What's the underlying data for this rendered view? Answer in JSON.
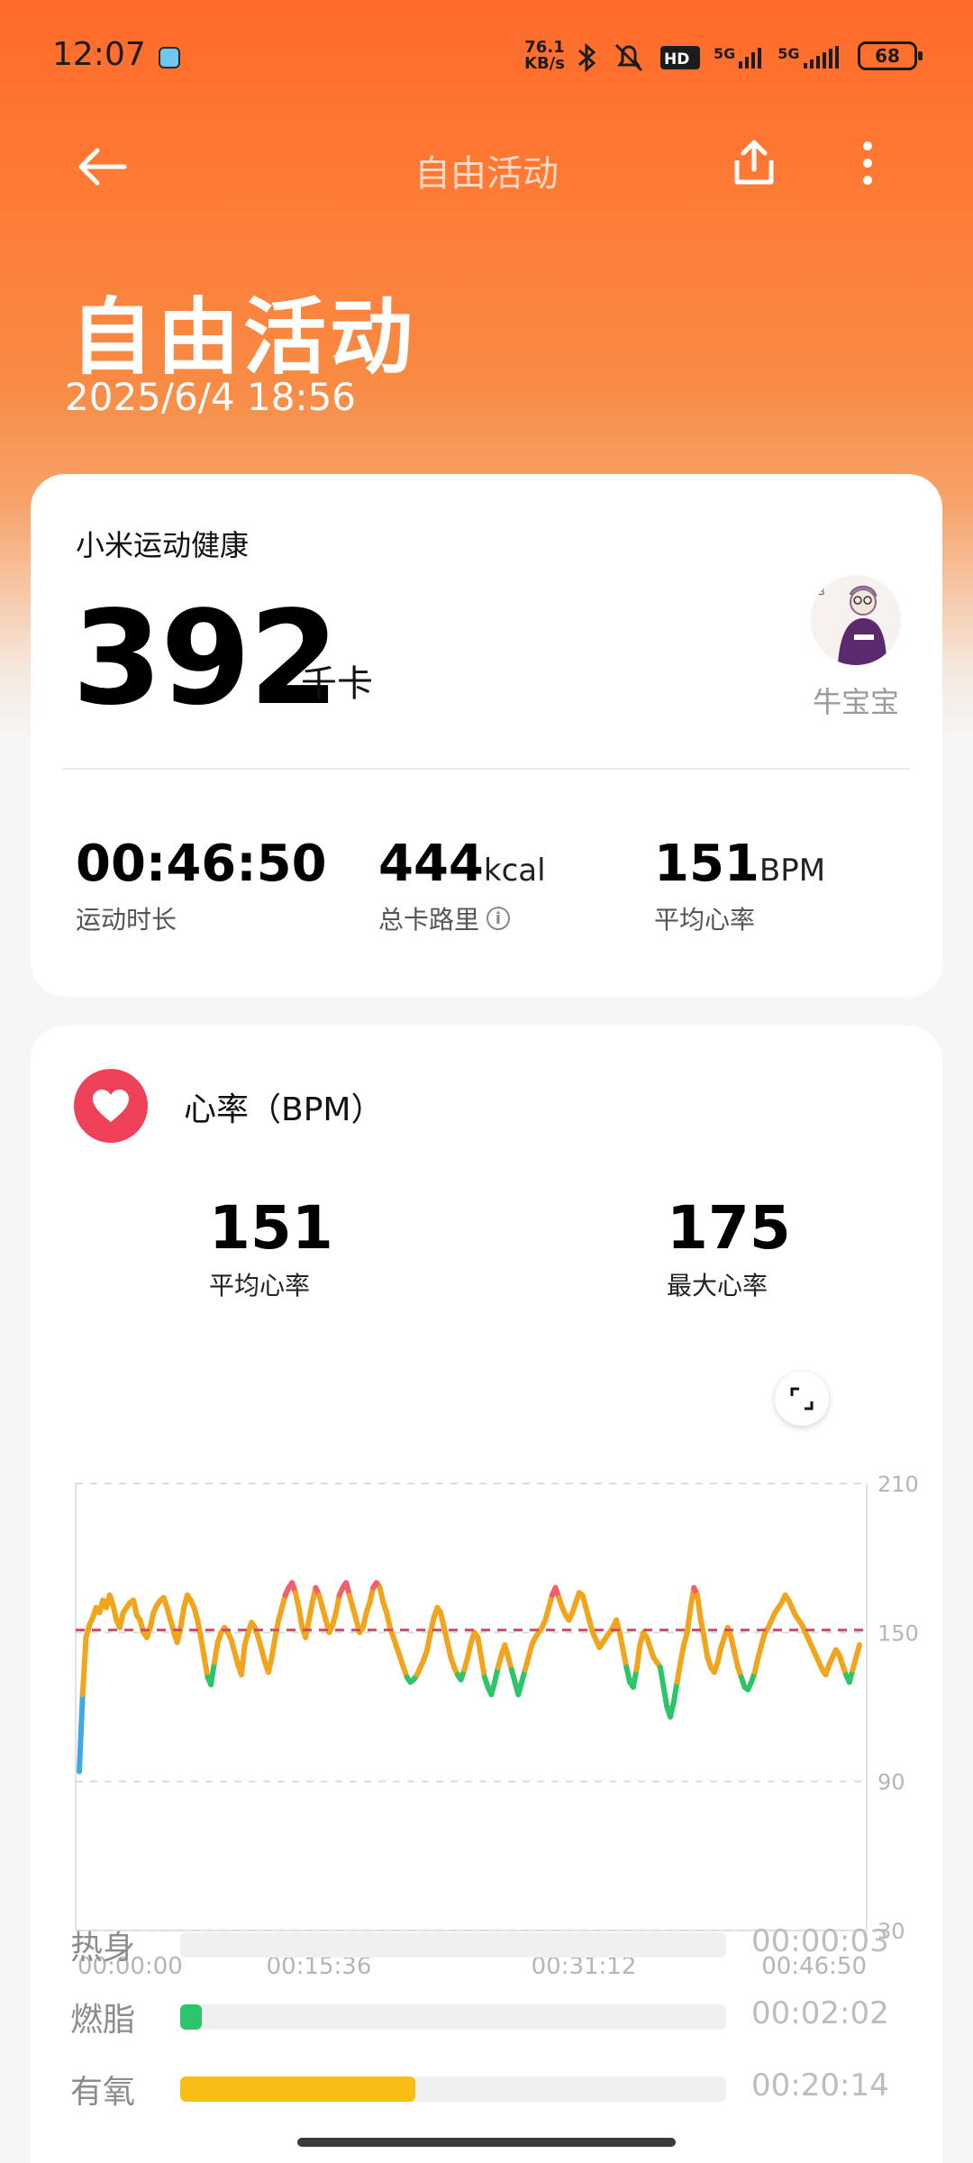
{
  "status_bar": {
    "time": "12:07",
    "net_speed_value": "76.1",
    "net_speed_unit": "KB/s",
    "network1": "5G",
    "network2": "5G",
    "battery": "68"
  },
  "app_bar": {
    "title": "自由活动",
    "back_icon": "arrow-left-icon",
    "share_icon": "share-icon",
    "more_icon": "more-vertical-icon"
  },
  "hero": {
    "title": "自由活动",
    "date": "2025/6/4 18:56"
  },
  "summary": {
    "brand": "小米运动健康",
    "calories_value": "392",
    "calories_unit": "千卡",
    "user_name": "牛宝宝",
    "stats": [
      {
        "value": "00:46:50",
        "unit": "",
        "label": "运动时长"
      },
      {
        "value": "444",
        "unit": "kcal",
        "label": "总卡路里"
      },
      {
        "value": "151",
        "unit": "BPM",
        "label": "平均心率"
      }
    ]
  },
  "heart_rate": {
    "title": "心率（BPM）",
    "avg_value": "151",
    "avg_label": "平均心率",
    "max_value": "175",
    "max_label": "最大心率"
  },
  "chart_data": {
    "type": "line",
    "title": "",
    "xlabel": "",
    "ylabel": "",
    "ylim": [
      30,
      210
    ],
    "y_ticks": [
      "210",
      "150",
      "90",
      "30"
    ],
    "x_ticks": [
      "00:00:00",
      "00:15:36",
      "00:31:12",
      "00:46:50"
    ],
    "average_line": 151,
    "grid": true,
    "series": [
      {
        "values": [
          94,
          125,
          148,
          153,
          156,
          160,
          158,
          163,
          160,
          165,
          161,
          155,
          152,
          158,
          160,
          162,
          163,
          157,
          155,
          150,
          148,
          152,
          158,
          161,
          163,
          164,
          160,
          155,
          150,
          146,
          152,
          160,
          165,
          163,
          160,
          155,
          148,
          140,
          132,
          129,
          138,
          146,
          150,
          152,
          150,
          147,
          142,
          137,
          133,
          145,
          150,
          154,
          152,
          148,
          143,
          138,
          134,
          140,
          148,
          155,
          160,
          165,
          168,
          170,
          166,
          160,
          152,
          148,
          155,
          162,
          168,
          165,
          160,
          155,
          150,
          153,
          158,
          165,
          168,
          170,
          165,
          160,
          155,
          150,
          152,
          158,
          162,
          168,
          170,
          168,
          162,
          158,
          152,
          148,
          144,
          140,
          136,
          132,
          130,
          131,
          133,
          136,
          139,
          143,
          150,
          156,
          160,
          158,
          152,
          146,
          140,
          136,
          133,
          131,
          135,
          140,
          146,
          150,
          148,
          140,
          132,
          128,
          125,
          130,
          136,
          141,
          145,
          140,
          135,
          130,
          125,
          130,
          135,
          140,
          145,
          148,
          150,
          152,
          155,
          160,
          165,
          168,
          164,
          160,
          157,
          155,
          158,
          162,
          166,
          165,
          160,
          155,
          150,
          147,
          144,
          146,
          148,
          150,
          152,
          155,
          150,
          143,
          136,
          130,
          128,
          135,
          145,
          150,
          148,
          144,
          140,
          138,
          136,
          128,
          120,
          116,
          122,
          130,
          138,
          145,
          150,
          160,
          168,
          165,
          155,
          148,
          140,
          136,
          134,
          138,
          144,
          148,
          152,
          148,
          142,
          136,
          132,
          128,
          127,
          130,
          134,
          140,
          145,
          150,
          152,
          155,
          158,
          160,
          162,
          165,
          163,
          160,
          157,
          155,
          153,
          150,
          147,
          144,
          141,
          138,
          135,
          133,
          137,
          140,
          143,
          141,
          137,
          133,
          130,
          135,
          140,
          145
        ]
      }
    ]
  },
  "zones": [
    {
      "label": "热身",
      "time": "00:00:03",
      "fraction": 0.0,
      "color": "#c8c8c8"
    },
    {
      "label": "燃脂",
      "time": "00:02:02",
      "fraction": 0.04,
      "color": "#2ec56a"
    },
    {
      "label": "有氧",
      "time": "00:20:14",
      "fraction": 0.43,
      "color": "#f8be14"
    }
  ],
  "colors": {
    "accent": "#ff6a2a",
    "heart_icon_bg": "#f0415a",
    "avg_line": "#d04a6a"
  }
}
